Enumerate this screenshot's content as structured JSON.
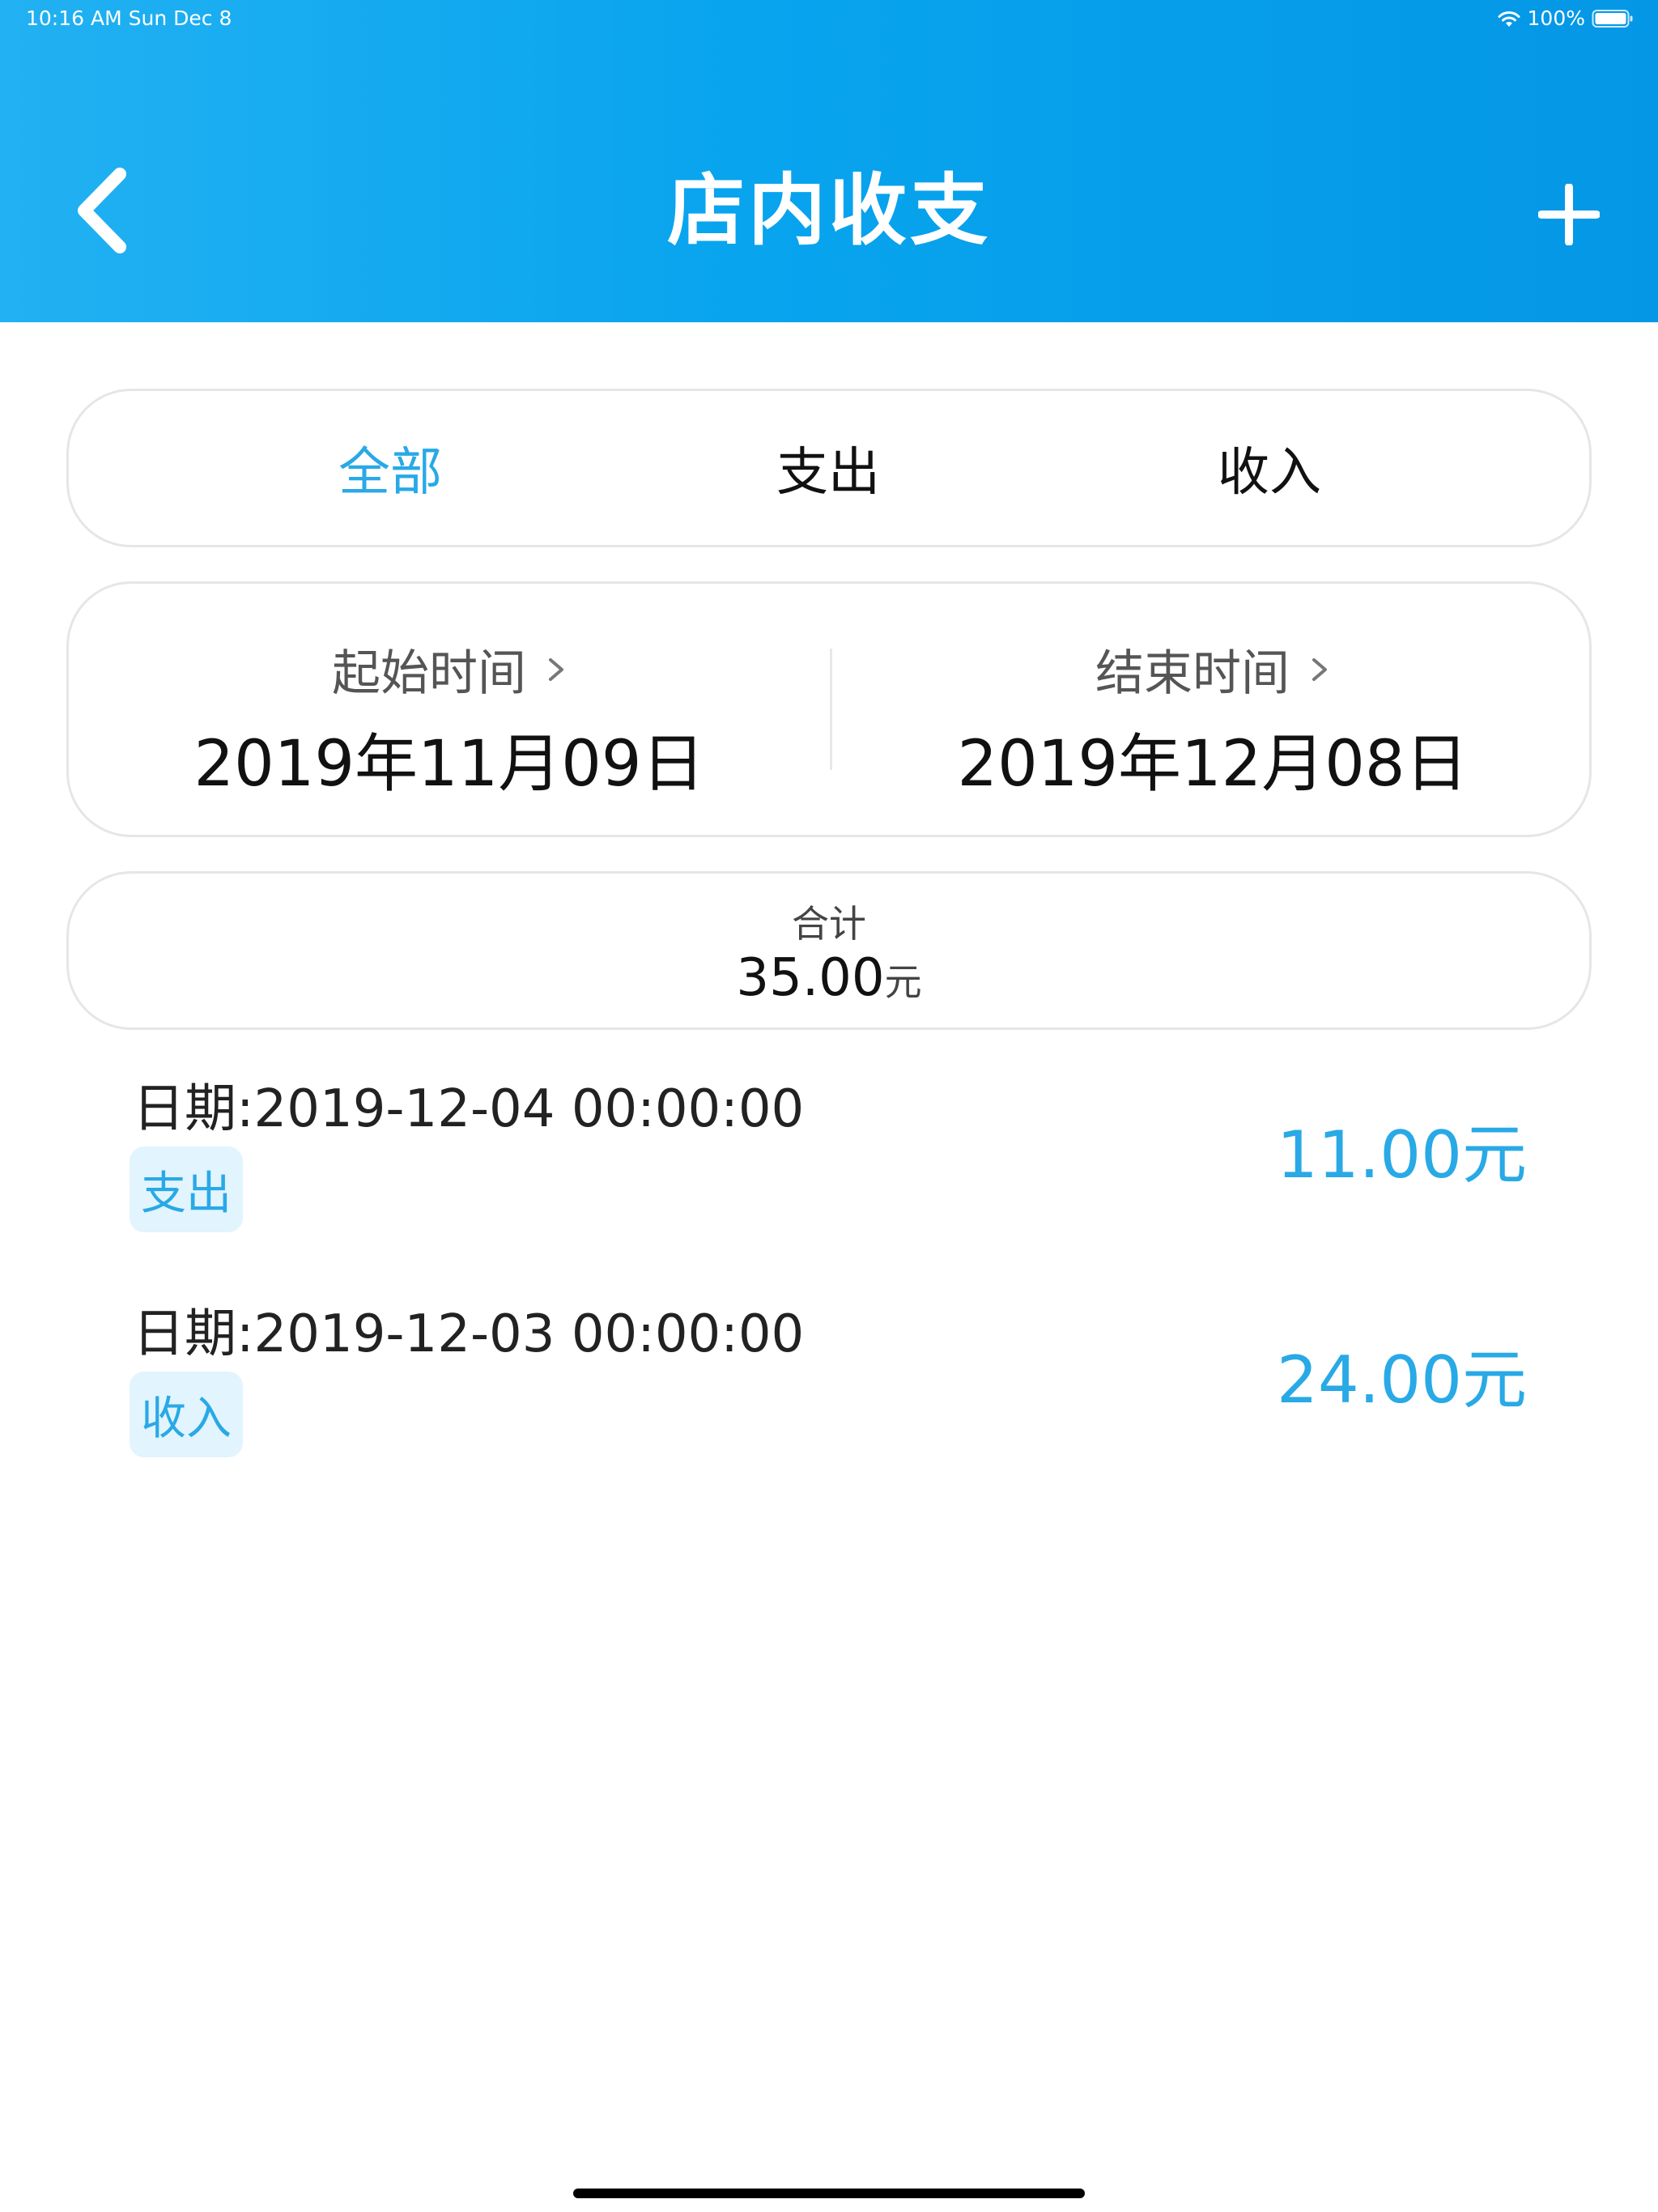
{
  "status_bar": {
    "time": "10:16 AM   Sun Dec 8",
    "battery": "100%"
  },
  "header": {
    "title": "店内收支",
    "back_icon": "chevron-left-icon",
    "add_icon": "plus-icon"
  },
  "filter_tabs": [
    {
      "label": "全部",
      "active": true
    },
    {
      "label": "支出",
      "active": false
    },
    {
      "label": "收入",
      "active": false
    }
  ],
  "date_range": {
    "start": {
      "label": "起始时间",
      "value": "2019年11月09日"
    },
    "end": {
      "label": "结束时间",
      "value": "2019年12月08日"
    }
  },
  "total": {
    "label": "合计",
    "amount": "35.00",
    "unit": "元"
  },
  "records": [
    {
      "date": "日期:2019-12-04 00:00:00",
      "type": "支出",
      "amount": "11.00元"
    },
    {
      "date": "日期:2019-12-03 00:00:00",
      "type": "收入",
      "amount": "24.00元"
    }
  ],
  "colors": {
    "accent": "#29a9e6",
    "header_start": "#22b1f2",
    "header_end": "#0497e6",
    "tag_bg": "#e2f4fd"
  }
}
